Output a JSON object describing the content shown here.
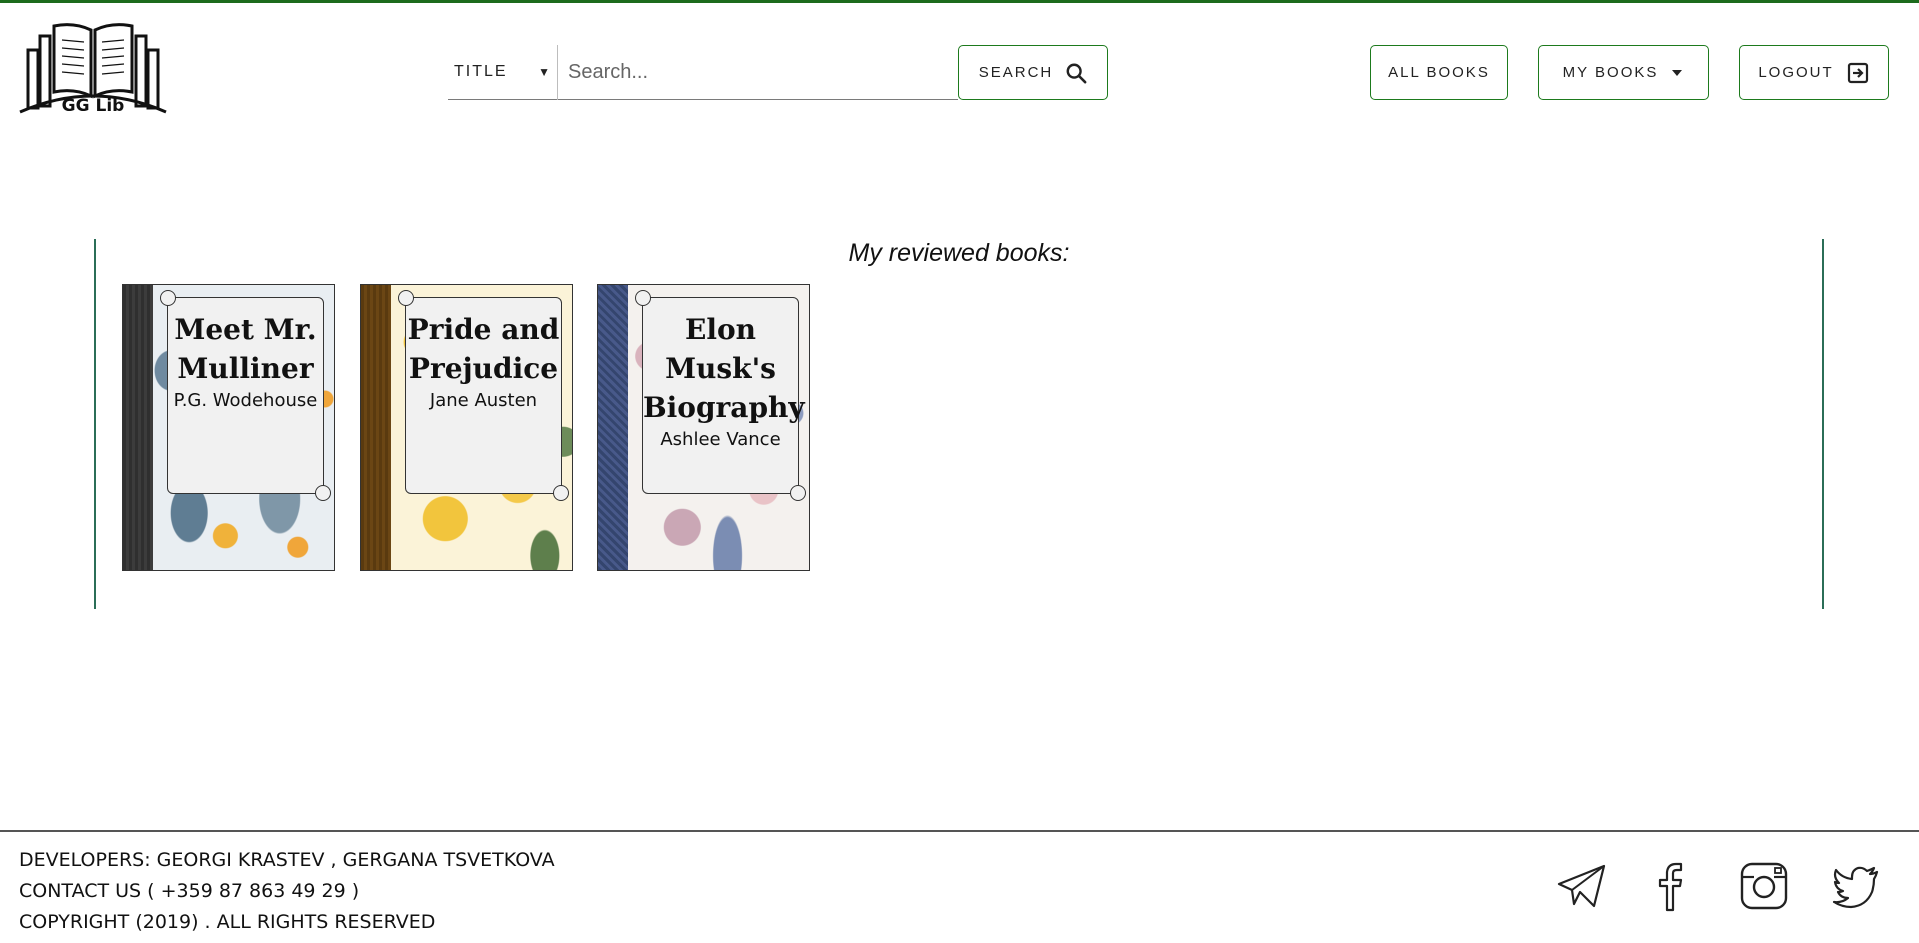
{
  "header": {
    "logo_text": "GG Lib",
    "search": {
      "selected_field": "TITLE",
      "placeholder": "Search...",
      "button_label": "SEARCH"
    },
    "nav": {
      "all_books": "ALL BOOKS",
      "my_books": "MY BOOKS",
      "logout": "LOGOUT"
    }
  },
  "main": {
    "title": "My reviewed books:",
    "books": [
      {
        "title_line1": "Meet Mr.",
        "title_line2": "Mulliner",
        "title_line3": "",
        "author": "P.G. Wodehouse"
      },
      {
        "title_line1": "Pride and",
        "title_line2": "Prejudice",
        "title_line3": "",
        "author": "Jane Austen"
      },
      {
        "title_line1": "Elon",
        "title_line2": "Musk's",
        "title_line3": "Biography",
        "author": "Ashlee Vance"
      }
    ]
  },
  "footer": {
    "developers": "DEVELOPERS: GEORGI KRASTEV , GERGANA TSVETKOVA",
    "contact": "CONTACT US ( +359 87 863 49 29 )",
    "copyright": "COPYRIGHT (2019) . ALL RIGHTS RESERVED"
  },
  "colors": {
    "accent": "#1d6b1d",
    "panel_border": "#2b6e57"
  },
  "icons": [
    "book-logo-icon",
    "search-icon",
    "caret-down-icon",
    "logout-icon",
    "telegram-icon",
    "facebook-icon",
    "instagram-icon",
    "twitter-icon"
  ]
}
